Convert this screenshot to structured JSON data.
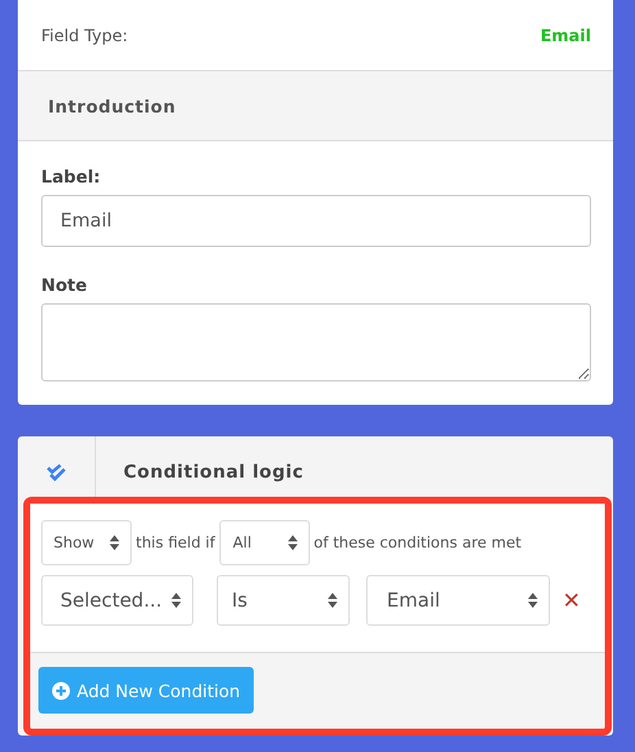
{
  "field_type": {
    "label": "Field Type:",
    "value": "Email"
  },
  "introduction": {
    "title": "Introduction",
    "label_field": {
      "label": "Label:",
      "value": "Email"
    },
    "note_field": {
      "label": "Note"
    }
  },
  "conditional_logic": {
    "title": "Conditional logic",
    "highlighted": true,
    "rule": {
      "action": "Show",
      "text_1": "this field if",
      "match": "All",
      "text_2": "of these conditions are met"
    },
    "conditions": [
      {
        "field": "Selected...",
        "operator": "Is",
        "value": "Email",
        "remove": "✕"
      }
    ],
    "add_button": "Add New Condition"
  }
}
